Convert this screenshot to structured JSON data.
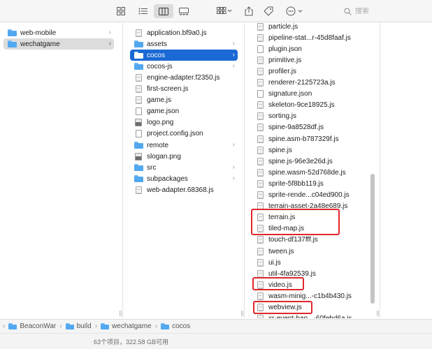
{
  "toolbar": {
    "search_placeholder": "搜索",
    "views": [
      "icon-view",
      "list-view",
      "column-view",
      "gallery-view"
    ],
    "active_view": "column-view"
  },
  "columns": {
    "sidebar_items": [
      {
        "label": "web-mobile",
        "kind": "folder",
        "selected": false
      },
      {
        "label": "wechatgame",
        "kind": "folder",
        "selected": true
      }
    ],
    "build_items": [
      {
        "label": "application.bf9a0.js",
        "kind": "file",
        "folder": false
      },
      {
        "label": "assets",
        "kind": "folder",
        "folder": true
      },
      {
        "label": "cocos",
        "kind": "folder",
        "folder": true,
        "selected": true
      },
      {
        "label": "cocos-js",
        "kind": "folder",
        "folder": true
      },
      {
        "label": "engine-adapter.f2350.js",
        "kind": "file",
        "folder": false
      },
      {
        "label": "first-screen.js",
        "kind": "file",
        "folder": false
      },
      {
        "label": "game.js",
        "kind": "file",
        "folder": false
      },
      {
        "label": "game.json",
        "kind": "json",
        "folder": false
      },
      {
        "label": "logo.png",
        "kind": "image",
        "folder": false
      },
      {
        "label": "project.config.json",
        "kind": "json",
        "folder": false
      },
      {
        "label": "remote",
        "kind": "folder",
        "folder": true
      },
      {
        "label": "slogan.png",
        "kind": "image",
        "folder": false
      },
      {
        "label": "src",
        "kind": "folder",
        "folder": true
      },
      {
        "label": "subpackages",
        "kind": "folder",
        "folder": true
      },
      {
        "label": "web-adapter.68368.js",
        "kind": "file",
        "folder": false
      }
    ],
    "cocos_items": [
      {
        "label": "particle.js",
        "kind": "file"
      },
      {
        "label": "pipeline-stat...r-45d8faaf.js",
        "kind": "file"
      },
      {
        "label": "plugin.json",
        "kind": "json"
      },
      {
        "label": "primitive.js",
        "kind": "file"
      },
      {
        "label": "profiler.js",
        "kind": "file"
      },
      {
        "label": "renderer-2125723a.js",
        "kind": "file"
      },
      {
        "label": "signature.json",
        "kind": "json"
      },
      {
        "label": "skeleton-9ce18925.js",
        "kind": "file"
      },
      {
        "label": "sorting.js",
        "kind": "file"
      },
      {
        "label": "spine-9a8528df.js",
        "kind": "file"
      },
      {
        "label": "spine.asm-b787329f.js",
        "kind": "file"
      },
      {
        "label": "spine.js",
        "kind": "file"
      },
      {
        "label": "spine.js-96e3e26d.js",
        "kind": "file"
      },
      {
        "label": "spine.wasm-52d768de.js",
        "kind": "file"
      },
      {
        "label": "sprite-5f8bb119.js",
        "kind": "file"
      },
      {
        "label": "sprite-rende...c04ed900.js",
        "kind": "file"
      },
      {
        "label": "terrain-asset-2a48e689.js",
        "kind": "file"
      },
      {
        "label": "terrain.js",
        "kind": "file"
      },
      {
        "label": "tiled-map.js",
        "kind": "file"
      },
      {
        "label": "touch-df137fff.js",
        "kind": "file"
      },
      {
        "label": "tween.js",
        "kind": "file"
      },
      {
        "label": "ui.js",
        "kind": "file"
      },
      {
        "label": "util-4fa92539.js",
        "kind": "file"
      },
      {
        "label": "video.js",
        "kind": "file"
      },
      {
        "label": "wasm-minig...-c1b4b430.js",
        "kind": "file"
      },
      {
        "label": "webview.js",
        "kind": "file"
      },
      {
        "label": "xr-event-han...-60febd6a.js",
        "kind": "file"
      }
    ]
  },
  "pathbar": {
    "crumbs": [
      "BeaconWar",
      "build",
      "wechatgame",
      "cocos"
    ]
  },
  "status": {
    "text": "63个项目，322.58 GB可用"
  },
  "colors": {
    "selection_blue": "#1a69d4",
    "highlight_red": "#e0262b",
    "folder_blue": "#52a8f0"
  }
}
